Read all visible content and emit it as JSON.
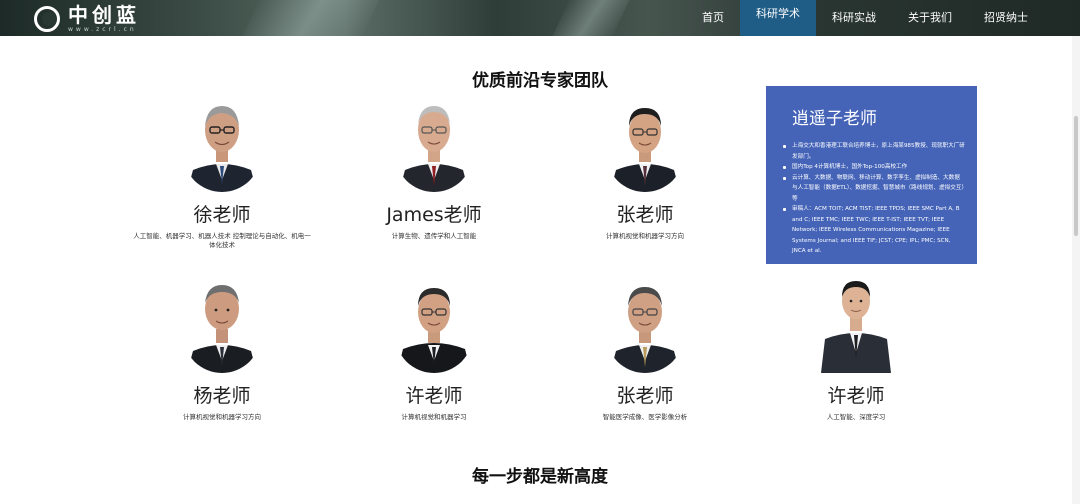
{
  "header": {
    "logo_text": "中创蓝",
    "logo_sub": "www.zcrl.cn",
    "nav": [
      "首页",
      "科研学术",
      "科研实战",
      "关于我们",
      "招贤纳士"
    ],
    "active_nav": "科研学术"
  },
  "team_section": {
    "title": "优质前沿专家团队"
  },
  "experts": [
    {
      "name": "徐老师",
      "desc": "人工智能、机器学习、机器人技术 控制理论与自动化、机电一体化技术",
      "icon": "avatar-senior-glasses"
    },
    {
      "name": "James老师",
      "desc": "计算生物、遗传学和人工智能",
      "icon": "avatar-senior-tie"
    },
    {
      "name": "张老师",
      "desc": "计算机视觉和机器学习方向",
      "icon": "avatar-glasses-suit"
    },
    {
      "name": "杨老师",
      "desc": "计算机视觉和机器学习方向",
      "icon": "avatar-suit"
    },
    {
      "name": "许老师",
      "desc": "计算机视觉和机器学习",
      "icon": "avatar-glasses-robe"
    },
    {
      "name": "张老师",
      "desc": "智能医学成像、医学影像分析",
      "icon": "avatar-glasses-suit"
    },
    {
      "name": "许老师",
      "desc": "人工智能、深度学习",
      "icon": "avatar-young-suit"
    }
  ],
  "featured": {
    "name": "逍遥子老师",
    "bullets": [
      "上海交大和香港理工联合培养博士，原上海某985教授、现就职大厂研发部门。",
      "国内Top 4计算机博士，国外Top-100高校工作",
      "云计算、大数据、物联网、移动计算、数字孪生、虚拟制造、大数据与人工智能（数据ETL）、数据挖掘、智慧城市（路线规划、虚拟交互）等",
      "审稿人：ACM TOIT; ACM TIST; IEEE TPDS; IEEE SMC Part A, B and C; IEEE TMC; IEEE TWC; IEEE T-IST; IEEE TVT; IEEE Network; IEEE Wireless Communications Magazine; IEEE Systems Journal; and IEEE TIF; JCST; CPE; IPL; PMC; SCN, JNCA et al."
    ]
  },
  "next_section": {
    "title": "每一步都是新高度"
  },
  "colors": {
    "accent_nav": "#1f5c86",
    "feature_bg": "#4564b8"
  }
}
